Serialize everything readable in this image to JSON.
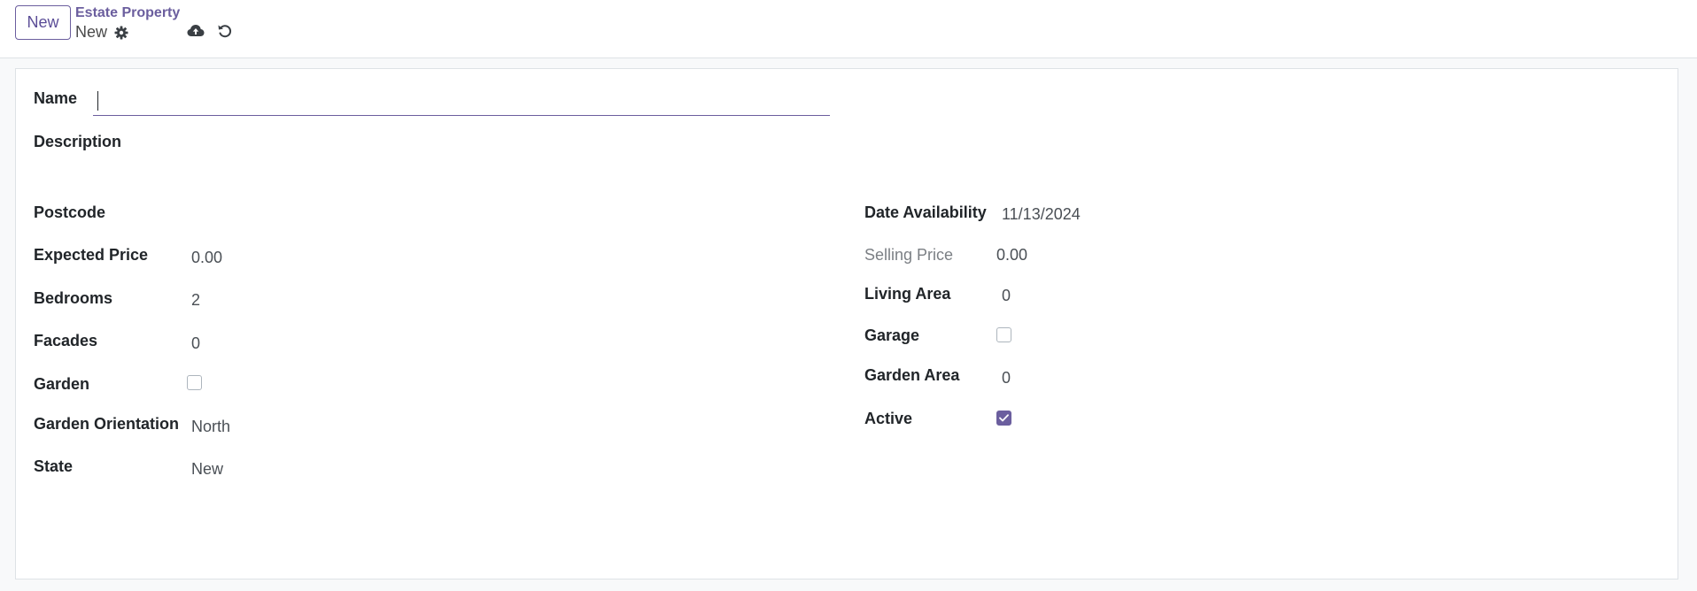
{
  "toolbar": {
    "new_label": "New",
    "breadcrumb_parent": "Estate Property",
    "breadcrumb_current": "New"
  },
  "icons": {
    "gear": "gear-icon",
    "save": "cloud-upload-icon",
    "discard": "undo-icon"
  },
  "colors": {
    "accent": "#6b5e9e",
    "border": "#dee2e6",
    "background": "#f8f9fa"
  },
  "form": {
    "name_label": "Name",
    "name_value": "",
    "description_label": "Description",
    "left": {
      "postcode_label": "Postcode",
      "postcode_value": "",
      "expected_price_label": "Expected Price",
      "expected_price_value": "0.00",
      "bedrooms_label": "Bedrooms",
      "bedrooms_value": "2",
      "facades_label": "Facades",
      "facades_value": "0",
      "garden_label": "Garden",
      "garden_checked": false,
      "garden_orientation_label": "Garden Orientation",
      "garden_orientation_value": "North",
      "state_label": "State",
      "state_value": "New"
    },
    "right": {
      "date_availability_label": "Date Availability",
      "date_availability_value": "11/13/2024",
      "selling_price_label": "Selling Price",
      "selling_price_value": "0.00",
      "living_area_label": "Living Area",
      "living_area_value": "0",
      "garage_label": "Garage",
      "garage_checked": false,
      "garden_area_label": "Garden Area",
      "garden_area_value": "0",
      "active_label": "Active",
      "active_checked": true
    }
  }
}
